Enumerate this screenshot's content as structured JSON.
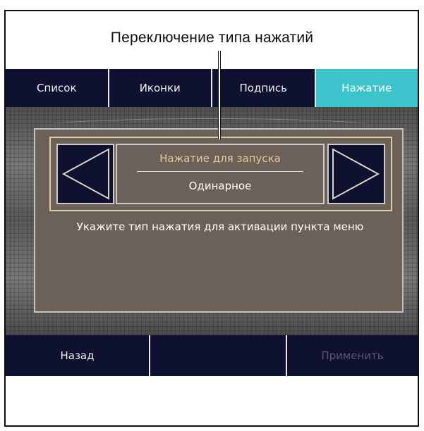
{
  "callout": {
    "label": "Переключение типа нажатий"
  },
  "tabs": [
    {
      "label": "Список"
    },
    {
      "label": "Иконки"
    },
    {
      "label": "Подпись"
    },
    {
      "label": "Нажатие",
      "active": true
    }
  ],
  "selector": {
    "label": "Нажатие для запуска",
    "value": "Одинарное",
    "prev_icon": "triangle-left-icon",
    "next_icon": "triangle-right-icon"
  },
  "hint": "Укажите тип нажатия для активации пункта меню",
  "bottom": {
    "back_label": "Назад",
    "apply_label": "Применить"
  },
  "colors": {
    "bar_bg": "#0f1130",
    "active_tab": "#3cc3cc",
    "card_bg": "#6b6158",
    "selector_border": "#d9cfa2",
    "selector_label": "#e3c89c",
    "disabled_text": "#5a5b6e"
  }
}
